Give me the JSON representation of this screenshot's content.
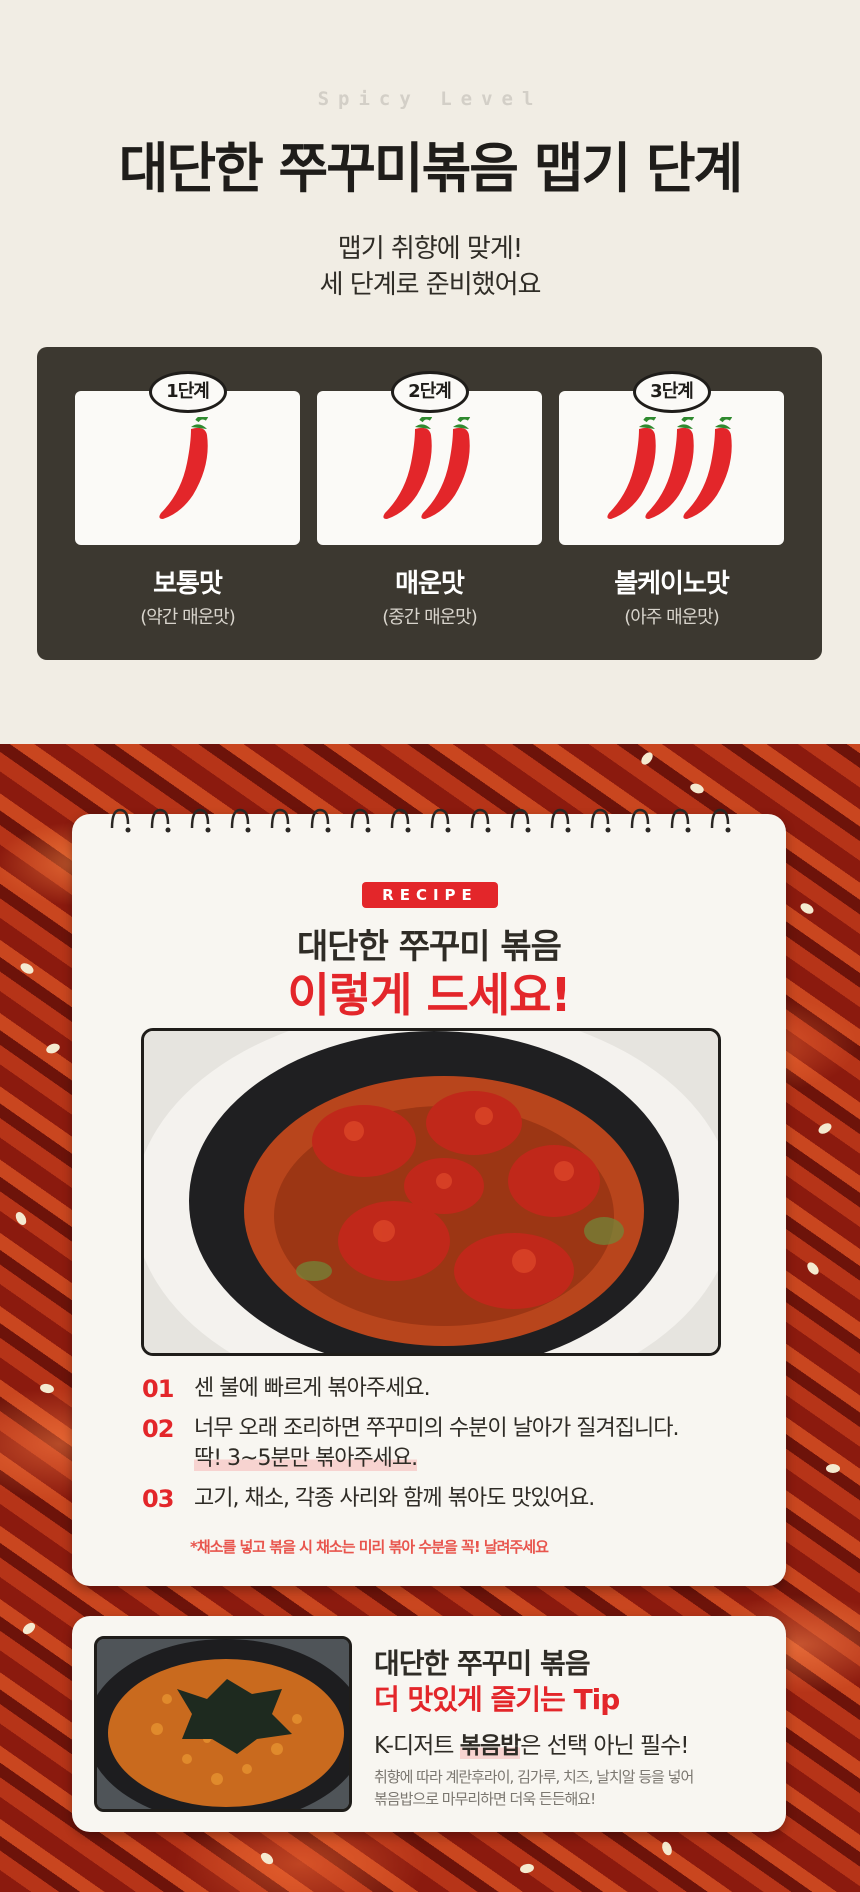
{
  "header": {
    "eyebrow": "Spicy Level",
    "title": "대단한 쭈꾸미볶음 맵기 단계",
    "subtitle_line1": "맵기 취향에 맞게!",
    "subtitle_line2": "세 단계로 준비했어요"
  },
  "levels": [
    {
      "badge": "1단계",
      "name": "보통맛",
      "desc": "(약간 매운맛)",
      "peppers": 1
    },
    {
      "badge": "2단계",
      "name": "매운맛",
      "desc": "(중간 매운맛)",
      "peppers": 2
    },
    {
      "badge": "3단계",
      "name": "볼케이노맛",
      "desc": "(아주 매운맛)",
      "peppers": 3
    }
  ],
  "recipe": {
    "tag": "RECIPE",
    "title_line1": "대단한 쭈꾸미 볶음",
    "title_line2": "이렇게 드세요!",
    "steps": [
      {
        "num": "01",
        "text": "센 불에 빠르게 볶아주세요."
      },
      {
        "num": "02",
        "text": "너무 오래 조리하면 쭈꾸미의 수분이 날아가 질겨집니다.",
        "text2": "딱! 3~5분만 볶아주세요."
      },
      {
        "num": "03",
        "text": "고기, 채소, 각종 사리와 함께 볶아도 맛있어요."
      }
    ],
    "note": "*채소를 넣고 볶을 시 채소는 미리 볶아 수분을 꼭! 날려주세요"
  },
  "tip": {
    "title_line1": "대단한 쭈꾸미 볶음",
    "title_line2": "더 맛있게 즐기는 Tip",
    "line_prefix": "K-디저트 ",
    "line_bold": "볶음밥",
    "line_suffix": "은 선택 아닌 필수!",
    "desc_line1": "취향에 따라 계란후라이, 김가루, 치즈, 날치알 등을 넣어",
    "desc_line2": "볶음밥으로 마무리하면 더욱 든든해요!"
  },
  "colors": {
    "accent": "#e3262a",
    "panel": "#3c3830",
    "background": "#f1ede4"
  }
}
